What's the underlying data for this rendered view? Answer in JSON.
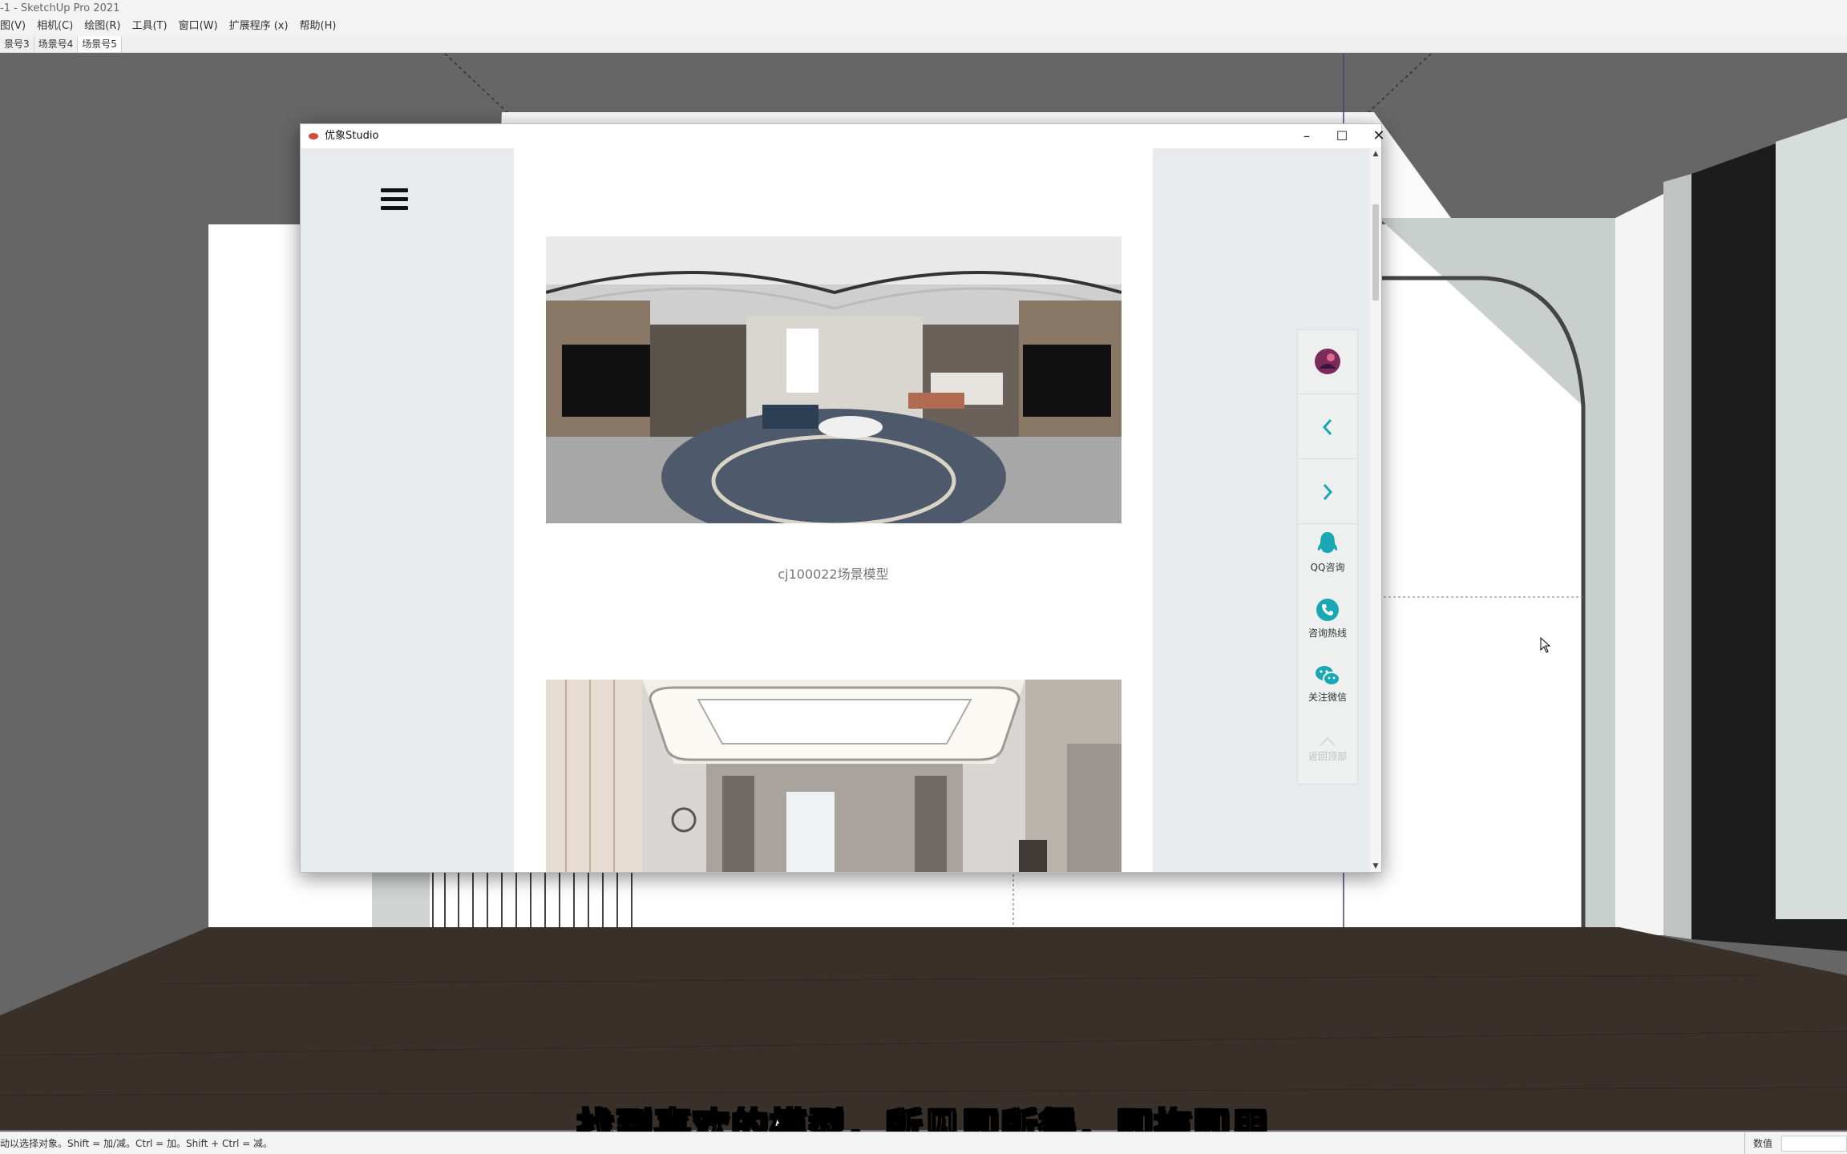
{
  "app": {
    "title": "-1 - SketchUp Pro 2021",
    "menus": [
      "图(V)",
      "相机(C)",
      "绘图(R)",
      "工具(T)",
      "窗口(W)",
      "扩展程序 (x)",
      "帮助(H)"
    ],
    "scene_tabs": [
      {
        "label": "景号3",
        "active": false
      },
      {
        "label": "场景号4",
        "active": false
      },
      {
        "label": "场景号5",
        "active": true
      }
    ]
  },
  "status": {
    "hint": "动以选择对象。Shift = 加/减。Ctrl = 加。Shift + Ctrl = 减。",
    "vcb_label": "数值",
    "vcb_value": ""
  },
  "subtitle": "找到喜欢的模型，所见即所得，即拖即用",
  "plugin": {
    "title": "优象Studio",
    "controls": {
      "minimize": "–",
      "maximize": "☐",
      "close": "✕"
    },
    "cards": [
      {
        "caption": "cj100022场景模型",
        "image": "panorama-living-room"
      },
      {
        "caption": "",
        "image": "bedroom-ceiling-render"
      }
    ],
    "sidebar": {
      "avatar": "avatar-icon",
      "prev": "chevron-left-icon",
      "next": "chevron-right-icon",
      "qq": "QQ咨询",
      "hotline": "咨询热线",
      "wechat": "关注微信",
      "top": "返回顶部"
    },
    "accent_color": "#1aa7b5"
  }
}
